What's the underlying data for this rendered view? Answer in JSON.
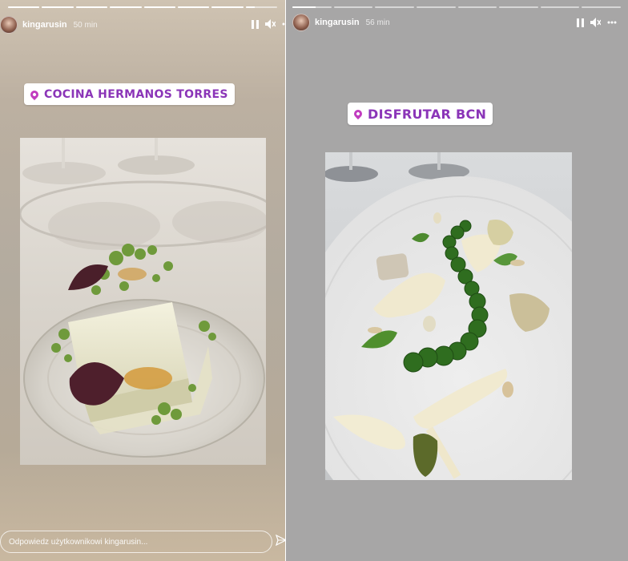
{
  "left_story": {
    "username": "kingarusin",
    "time": "50 min",
    "location": "COCINA HERMANOS TORRES",
    "reply_placeholder": "Odpowiedz użytkownikowi kingarusin...",
    "progress_segments": 8,
    "progress_active_index": 7,
    "progress_active_fraction": 0.3
  },
  "right_story": {
    "username": "kingarusin",
    "time": "56 min",
    "location": "DISFRUTAR BCN",
    "progress_segments": 8,
    "progress_active_index": 0,
    "progress_active_fraction": 0.6
  },
  "icons": {
    "pause": "pause-icon",
    "mute": "mute-icon",
    "more": "more-icon",
    "location": "location-pin-icon",
    "send": "send-icon"
  },
  "colors": {
    "location_text": "#8b35b8",
    "location_pin": "#c13cbf"
  }
}
